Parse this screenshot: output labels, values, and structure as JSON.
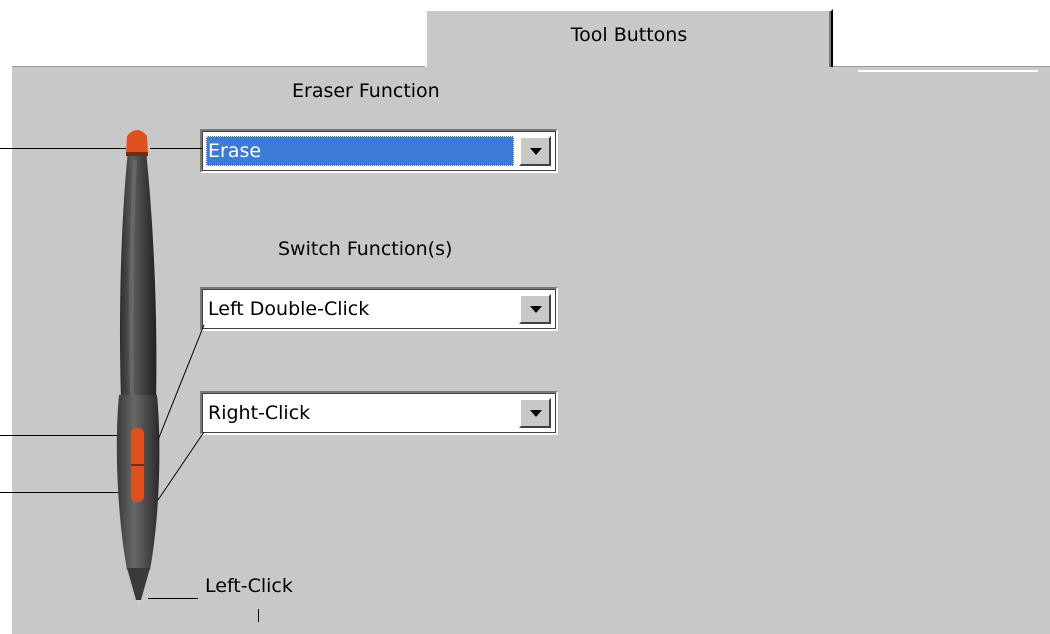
{
  "tab": {
    "label": "Tool Buttons"
  },
  "eraser": {
    "heading": "Eraser Function",
    "value": "Erase"
  },
  "switches": {
    "heading": "Switch Function(s)",
    "upper_value": "Left Double-Click",
    "lower_value": "Right-Click"
  },
  "tip": {
    "label": "Left-Click"
  },
  "colors": {
    "panel": "#c8c8c8",
    "selection": "#3c7bd6",
    "pen_body": "#4a4a4a",
    "pen_accent": "#e0501c"
  }
}
